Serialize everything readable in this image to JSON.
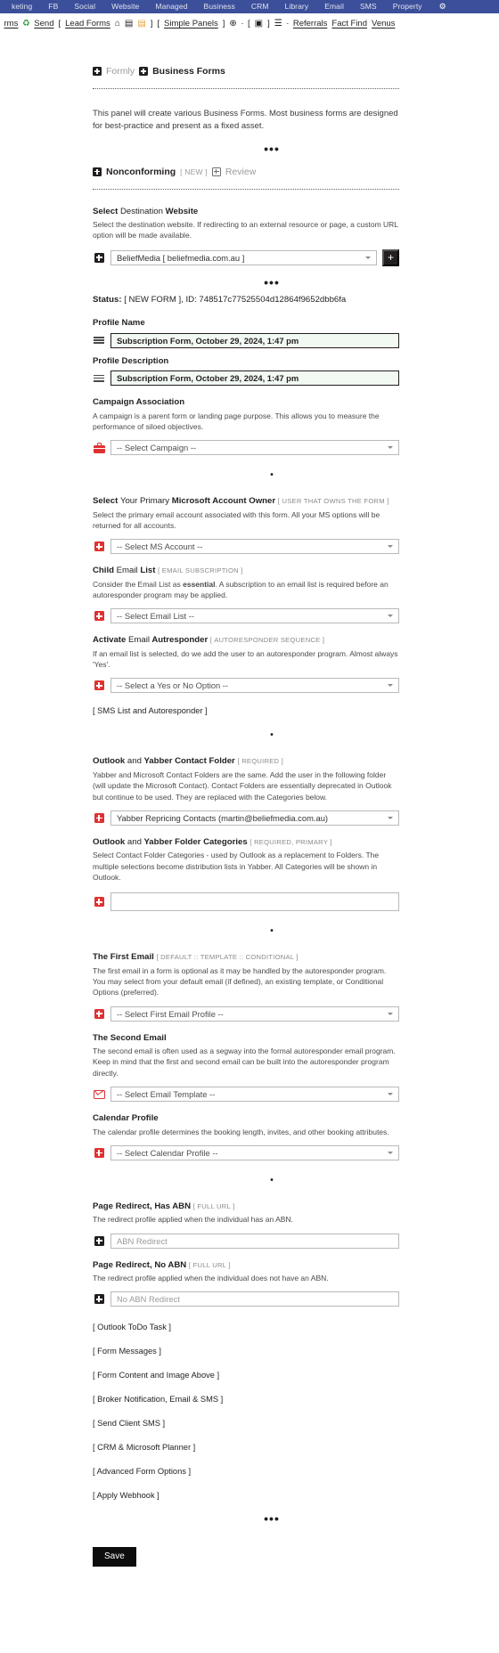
{
  "topnav": {
    "items": [
      "keting",
      "FB",
      "Social",
      "Website",
      "Managed",
      "Business",
      "CRM",
      "Library",
      "Email",
      "SMS",
      "Property"
    ],
    "gear": "⚙",
    "bg_color": "#3c4f9a"
  },
  "subnav": {
    "prefix": "rms",
    "recycle_icon": "♻",
    "send": "Send",
    "b_open": "[",
    "lead_forms": "Lead Forms",
    "icon_home": "⌂",
    "icon_calendar": "▤",
    "icon_briefcase": "▤",
    "b_close": "]",
    "b2_open": "[",
    "simple_panels": "Simple Panels",
    "b2_close": "]",
    "icon_globe": "⊕",
    "dot1": "·",
    "b3_open": "[",
    "icon_square": "▣",
    "b3_close": "]",
    "icon_list": "☰",
    "dot2": "·",
    "referrals": "Referrals",
    "fact_find": "Fact Find",
    "venus": "Venus"
  },
  "crumbs": {
    "formly": "Formly",
    "business_forms": "Business Forms"
  },
  "intro": "This panel will create various Business Forms. Most business forms are designed for best-practice and present as a fixed asset.",
  "separators": {
    "ellipsis": "•••",
    "dot": "•"
  },
  "nonconforming": {
    "title": "Nonconforming",
    "tag": "[ NEW ]",
    "review": "Review"
  },
  "destination": {
    "label_1": "Select",
    "label_2": "Destination",
    "label_3": "Website",
    "help": "Select the destination website. If redirecting to an external resource or page, a custom URL option will be made available.",
    "value": "BeliefMedia [ beliefmedia.com.au ]",
    "add_label": "+"
  },
  "status": {
    "label": "Status:",
    "value": "[ NEW FORM ], ID: 748517c77525504d12864f9652dbb6fa"
  },
  "profile_name": {
    "label": "Profile Name",
    "value": "Subscription Form, October 29, 2024, 1:47 pm"
  },
  "profile_description": {
    "label": "Profile Description",
    "value": "Subscription Form, October 29, 2024, 1:47 pm"
  },
  "campaign": {
    "label": "Campaign Association",
    "help": "A campaign is a parent form or landing page purpose. This allows you to measure the performance of siloed objectives.",
    "value": "-- Select Campaign --"
  },
  "ms_account": {
    "label_1": "Select",
    "label_2": "Your Primary",
    "label_3": "Microsoft Account Owner",
    "tag": "[ USER THAT OWNS THE FORM ]",
    "help": "Select the primary email account associated with this form. All your MS options will be returned for all accounts.",
    "value": "-- Select MS Account --"
  },
  "email_list": {
    "label_1": "Child",
    "label_2": "Email",
    "label_3": "List",
    "tag": "[ EMAIL SUBSCRIPTION ]",
    "help_a": "Consider the Email List as ",
    "help_b": "essential",
    "help_c": ". A subscription to an email list is required before an autoresponder program may be applied.",
    "value": "-- Select Email List --"
  },
  "autoresponder": {
    "label_1": "Activate",
    "label_2": "Email",
    "label_3": "Autresponder",
    "tag": "[ AUTORESPONDER SEQUENCE ]",
    "help": "If an email list is selected, do we add the user to an autoresponder program. Almost always 'Yes'.",
    "value": "-- Select a Yes or No Option --",
    "sms_bracket": "[ SMS List and Autoresponder ]"
  },
  "contact_folder": {
    "label_1": "Outlook",
    "label_2": "and",
    "label_3": "Yabber Contact Folder",
    "tag": "[ REQUIRED ]",
    "help": "Yabber and Microsoft Contact Folders are the same. Add the user in the following folder (will update the Microsoft Contact). Contact Folders are essentially deprecated in Outlook but continue to be used. They are replaced with the Categories below.",
    "value": "Yabber Repricing Contacts (martin@beliefmedia.com.au)"
  },
  "folder_categories": {
    "label_1": "Outlook",
    "label_2": "and",
    "label_3": "Yabber Folder Categories",
    "tag": "[ REQUIRED, PRIMARY ]",
    "help": "Select Contact Folder Categories - used by Outlook as a replacement to Folders. The multiple selections become distribution lists in Yabber. All Categories will be shown in Outlook.",
    "value": ""
  },
  "first_email": {
    "label_1": "The First Email",
    "tag": "[ DEFAULT :: TEMPLATE :: CONDITIONAL ]",
    "help": "The first email in a form is optional as it may be handled by the autoresponder program. You may select from your default email (if defined), an existing template, or Conditional Options (preferred).",
    "value": "-- Select First Email Profile --"
  },
  "second_email": {
    "label_1": "The Second Email",
    "help": "The second email is often used as a segway into the formal autoresponder email program. Keep in mind that the first and second email can be built into the autoresponder program directly.",
    "value": "-- Select Email Template --"
  },
  "calendar_profile": {
    "label_1": "Calendar Profile",
    "help": "The calendar profile determines the booking length, invites, and other booking attributes.",
    "value": "-- Select Calendar Profile --"
  },
  "redirect_abn": {
    "label_1": "Page Redirect, Has ABN",
    "tag": "[ FULL URL ]",
    "help": "The redirect profile applied when the individual has an ABN.",
    "placeholder": "ABN Redirect",
    "value": ""
  },
  "redirect_no_abn": {
    "label_1": "Page Redirect, No ABN",
    "tag": "[ FULL URL ]",
    "help": "The redirect profile applied when the individual does not have an ABN.",
    "placeholder": "No ABN Redirect",
    "value": ""
  },
  "link_items": [
    "[ Outlook ToDo Task ]",
    "[ Form Messages ]",
    "[ Form Content and Image Above ]",
    "[ Broker Notification, Email & SMS ]",
    "[ Send Client SMS ]",
    "[ CRM & Microsoft Planner ]",
    "[ Advanced Form Options ]",
    "[ Apply Webhook ]"
  ],
  "save": {
    "label": "Save"
  },
  "colors": {
    "nav_blue": "#3c4f9a",
    "accent_red": "#e03131",
    "field_green": "#f2f8f2",
    "save_black": "#0d0d0d"
  }
}
